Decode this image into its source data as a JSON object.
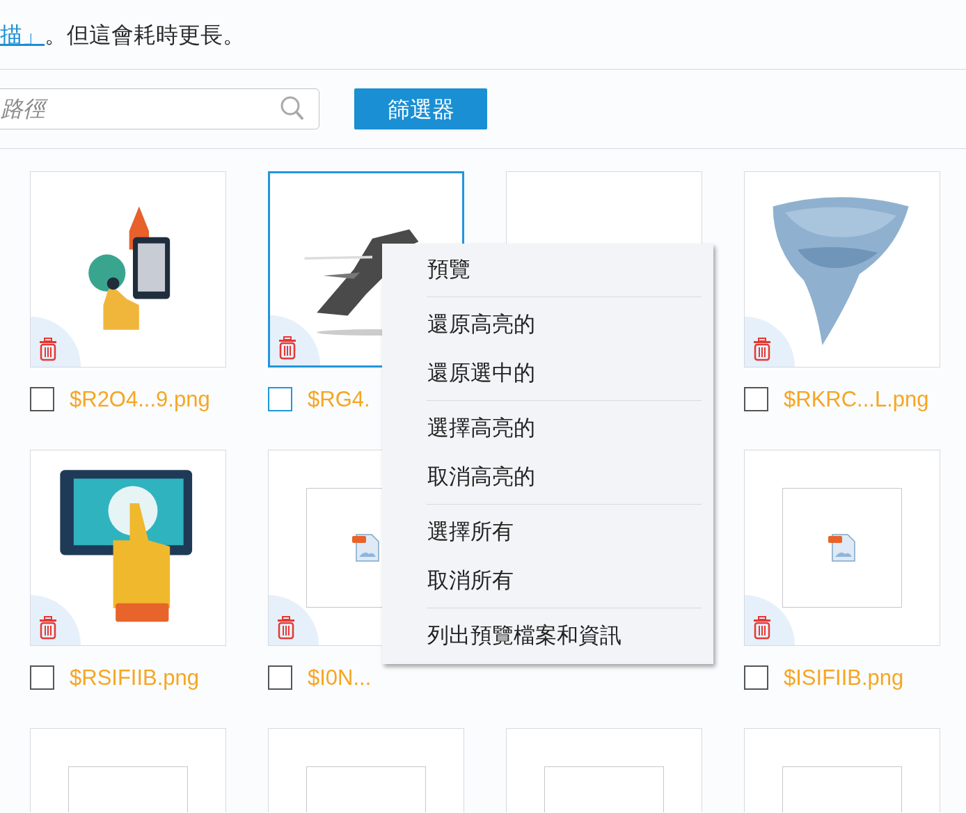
{
  "notice": {
    "link": "描」",
    "text": "。但這會耗時更長。"
  },
  "search": {
    "placeholder": "路徑"
  },
  "filter_button": "篩選器",
  "tiles": [
    {
      "kind": "picture",
      "filename": "$R2O4...9.png",
      "selected": false,
      "checked": false
    },
    {
      "kind": "picture",
      "filename": "$RG4.",
      "selected": true,
      "checked": false
    },
    {
      "kind": "blank",
      "selected": false
    },
    {
      "kind": "picture",
      "filename": "$RKRC...L.png",
      "selected": false,
      "checked": false
    },
    {
      "kind": "picture",
      "filename": "$RSIFIIB.png",
      "selected": false,
      "checked": false
    },
    {
      "kind": "file",
      "filename": "$I0N...",
      "selected": false,
      "checked": false
    },
    {
      "kind": "hidden"
    },
    {
      "kind": "file",
      "filename": "$ISIFIIB.png",
      "selected": false,
      "checked": false
    },
    {
      "kind": "file_partial",
      "selected": false
    },
    {
      "kind": "file_partial",
      "selected": false
    },
    {
      "kind": "file_partial",
      "selected": false
    },
    {
      "kind": "file_partial",
      "selected": false
    }
  ],
  "context_menu": {
    "groups": [
      [
        "預覽"
      ],
      [
        "還原高亮的",
        "還原選中的"
      ],
      [
        "選擇高亮的",
        "取消高亮的"
      ],
      [
        "選擇所有",
        "取消所有"
      ],
      [
        "列出預覽檔案和資訊"
      ]
    ]
  }
}
